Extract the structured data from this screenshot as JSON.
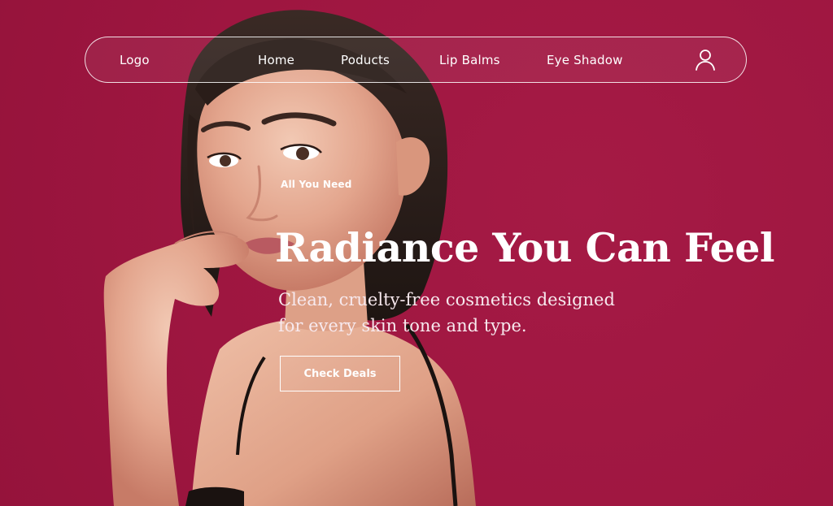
{
  "nav": {
    "logo": "Logo",
    "items": [
      {
        "label": "Home"
      },
      {
        "label": "Poducts"
      },
      {
        "label": "Lip Balms"
      },
      {
        "label": "Eye Shadow"
      }
    ],
    "user_icon": "user-icon"
  },
  "hero": {
    "eyebrow": "All You Need",
    "headline": "Radiance You Can Feel",
    "subcopy": "Clean, cruelty-free cosmetics designed for every skin tone and type.",
    "cta": "Check Deals",
    "image": "model-portrait"
  },
  "colors": {
    "background": "#a11842",
    "text": "#ffffff"
  }
}
